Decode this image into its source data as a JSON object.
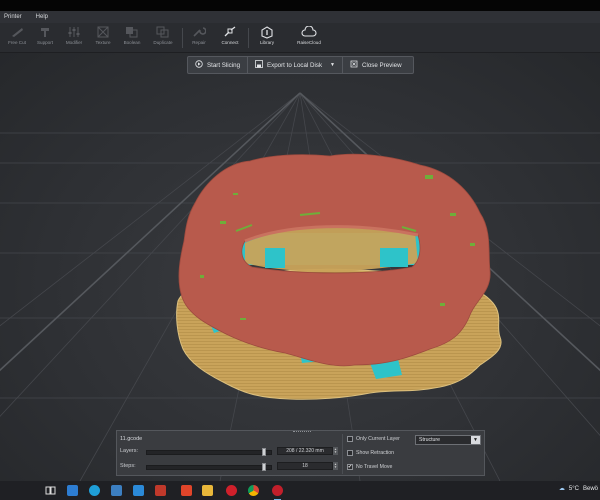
{
  "menu": {
    "items": [
      "Printer",
      "Help"
    ]
  },
  "toolbar": {
    "items": [
      {
        "key": "free-cut",
        "label": "Free Cut"
      },
      {
        "key": "support",
        "label": "Support"
      },
      {
        "key": "modifier",
        "label": "Modifier"
      },
      {
        "key": "texture",
        "label": "Texture"
      },
      {
        "key": "boolean",
        "label": "Boolean"
      },
      {
        "key": "duplicate",
        "label": "Duplicate"
      },
      {
        "key": "repair",
        "label": "Repair"
      },
      {
        "key": "connect",
        "label": "Connect"
      },
      {
        "key": "library",
        "label": "Library"
      },
      {
        "key": "raisecloud",
        "label": "RaiseCloud"
      }
    ]
  },
  "actions": {
    "start_slicing": "Start Slicing",
    "export": "Export to Local Disk",
    "close_preview": "Close Preview"
  },
  "preview_panel": {
    "file_name": "11.gcode",
    "layers_label": "Layers:",
    "layers_value": "208 / 22.320 mm",
    "layers_fraction": 0.96,
    "steps_label": "Steps:",
    "steps_value": "18",
    "steps_fraction": 0.96,
    "only_current_layer": {
      "label": "Only Current Layer",
      "checked": false
    },
    "show_retraction": {
      "label": "Show Retraction",
      "checked": false
    },
    "no_travel_move": {
      "label": "No Travel Move",
      "checked": true
    },
    "view_mode": "Structure"
  },
  "taskbar": {
    "weather_temp": "5°C",
    "weather_text": "Bewö"
  },
  "colors": {
    "model_outer_wall": "#b85a4c",
    "raft_infill": "#c9a35a",
    "support": "#2ec3c9",
    "inner_wall": "#6fae3a",
    "accent": "#3a8fdc"
  }
}
